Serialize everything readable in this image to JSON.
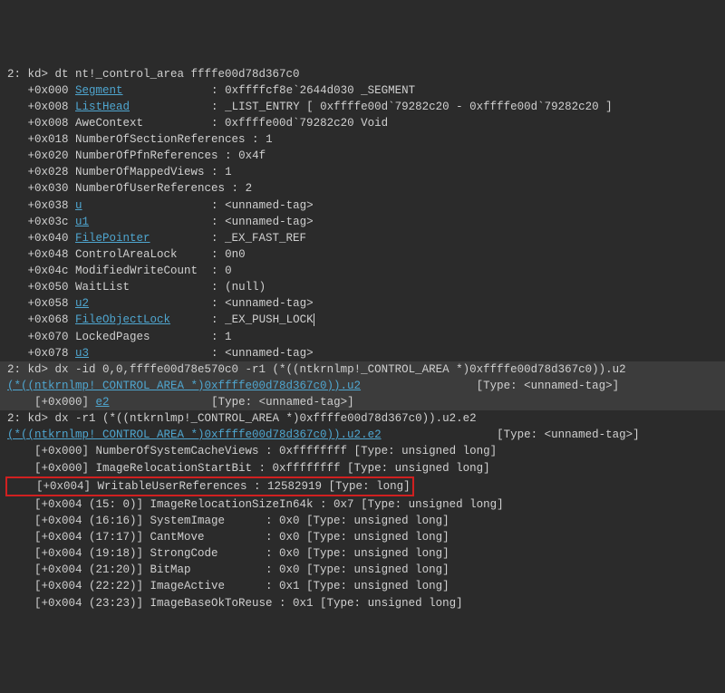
{
  "cmd1_prefix": "2: kd> ",
  "cmd1": "dt nt!_control_area ffffe00d78d367c0",
  "rows": [
    {
      "off": "   +0x000 ",
      "name": "Segment",
      "is_link": true,
      "pad": "             : ",
      "val": "0xffffcf8e`2644d030 _SEGMENT"
    },
    {
      "off": "   +0x008 ",
      "name": "ListHead",
      "is_link": true,
      "pad": "            : ",
      "val": "_LIST_ENTRY [ 0xffffe00d`79282c20 - 0xffffe00d`79282c20 ]"
    },
    {
      "off": "   +0x008 ",
      "name": "AweContext",
      "is_link": false,
      "pad": "          : ",
      "val": "0xffffe00d`79282c20 Void"
    },
    {
      "off": "   +0x018 ",
      "name": "NumberOfSectionReferences",
      "is_link": false,
      "pad": " : ",
      "val": "1"
    },
    {
      "off": "   +0x020 ",
      "name": "NumberOfPfnReferences",
      "is_link": false,
      "pad": " : ",
      "val": "0x4f"
    },
    {
      "off": "   +0x028 ",
      "name": "NumberOfMappedViews",
      "is_link": false,
      "pad": " : ",
      "val": "1"
    },
    {
      "off": "   +0x030 ",
      "name": "NumberOfUserReferences",
      "is_link": false,
      "pad": " : ",
      "val": "2"
    },
    {
      "off": "   +0x038 ",
      "name": "u",
      "is_link": true,
      "pad": "                   : ",
      "val": "<unnamed-tag>"
    },
    {
      "off": "   +0x03c ",
      "name": "u1",
      "is_link": true,
      "pad": "                  : ",
      "val": "<unnamed-tag>"
    },
    {
      "off": "   +0x040 ",
      "name": "FilePointer",
      "is_link": true,
      "pad": "         : ",
      "val": "_EX_FAST_REF"
    },
    {
      "off": "   +0x048 ",
      "name": "ControlAreaLock",
      "is_link": false,
      "pad": "     : ",
      "val": "0n0"
    },
    {
      "off": "   +0x04c ",
      "name": "ModifiedWriteCount",
      "is_link": false,
      "pad": "  : ",
      "val": "0"
    },
    {
      "off": "   +0x050 ",
      "name": "WaitList",
      "is_link": false,
      "pad": "            : ",
      "val": "(null)"
    },
    {
      "off": "   +0x058 ",
      "name": "u2",
      "is_link": true,
      "pad": "                  : ",
      "val": "<unnamed-tag>"
    },
    {
      "off": "   +0x068 ",
      "name": "FileObjectLock",
      "is_link": true,
      "pad": "      : ",
      "val": "_EX_PUSH_LOCK",
      "cursor": true
    },
    {
      "off": "   +0x070 ",
      "name": "LockedPages",
      "is_link": false,
      "pad": "         : ",
      "val": "1"
    },
    {
      "off": "   +0x078 ",
      "name": "u3",
      "is_link": true,
      "pad": "                  : ",
      "val": "<unnamed-tag>"
    }
  ],
  "cmd2_prefix": "2: kd> ",
  "cmd2": "dx -id 0,0,ffffe00d78e570c0 -r1 (*((ntkrnlmp!_CONTROL_AREA *)0xffffe00d78d367c0)).u2",
  "cmd2_out_link": "(*((ntkrnlmp!_CONTROL_AREA *)0xffffe00d78d367c0)).u2",
  "cmd2_out_type": "                 [Type: <unnamed-tag>]",
  "cmd2_sub_off": "    [+0x000] ",
  "cmd2_sub_name": "e2",
  "cmd2_sub_rest": "               [Type: <unnamed-tag>]",
  "cmd3_prefix": "2: kd> ",
  "cmd3": "dx -r1 (*((ntkrnlmp!_CONTROL_AREA *)0xffffe00d78d367c0)).u2.e2",
  "cmd3_out_link": "(*((ntkrnlmp!_CONTROL_AREA *)0xffffe00d78d367c0)).u2.e2",
  "cmd3_out_type": "                 [Type: <unnamed-tag>]",
  "bits": [
    {
      "text": "    [+0x000] NumberOfSystemCacheViews : 0xffffffff [Type: unsigned long]",
      "box": false
    },
    {
      "text": "    [+0x000] ImageRelocationStartBit : 0xffffffff [Type: unsigned long]",
      "box": false
    },
    {
      "text": "    [+0x004] WritableUserReferences : 12582919 [Type: long]",
      "box": true
    },
    {
      "text": "    [+0x004 (15: 0)] ImageRelocationSizeIn64k : 0x7 [Type: unsigned long]",
      "box": false
    },
    {
      "text": "    [+0x004 (16:16)] SystemImage      : 0x0 [Type: unsigned long]",
      "box": false
    },
    {
      "text": "    [+0x004 (17:17)] CantMove         : 0x0 [Type: unsigned long]",
      "box": false
    },
    {
      "text": "    [+0x004 (19:18)] StrongCode       : 0x0 [Type: unsigned long]",
      "box": false
    },
    {
      "text": "    [+0x004 (21:20)] BitMap           : 0x0 [Type: unsigned long]",
      "box": false
    },
    {
      "text": "    [+0x004 (22:22)] ImageActive      : 0x1 [Type: unsigned long]",
      "box": false
    },
    {
      "text": "    [+0x004 (23:23)] ImageBaseOkToReuse : 0x1 [Type: unsigned long]",
      "box": false
    }
  ]
}
